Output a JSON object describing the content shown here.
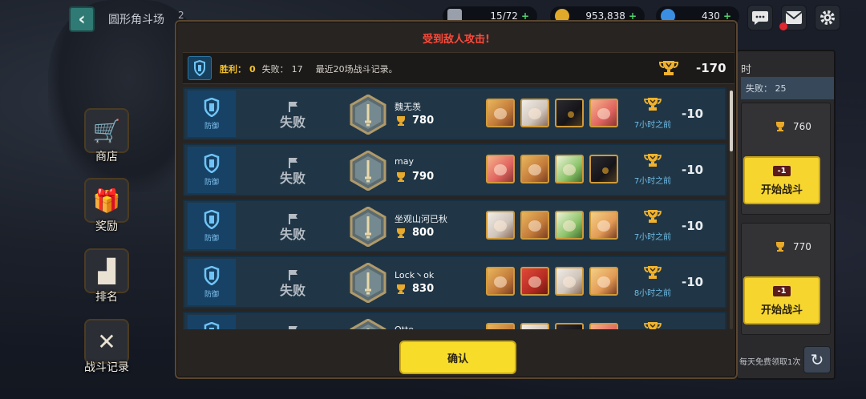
{
  "header": {
    "back_icon": "chevron-left-icon",
    "title": "圆形角斗场",
    "badge": "2",
    "resources": [
      {
        "icon": "stamina-icon",
        "value": "15/72"
      },
      {
        "icon": "gold-coin-icon",
        "value": "953,838"
      },
      {
        "icon": "gem-icon",
        "value": "430"
      }
    ]
  },
  "sidebar": {
    "items": [
      {
        "label": "商店",
        "icon": "cart-icon"
      },
      {
        "label": "奖励",
        "icon": "gift-icon"
      },
      {
        "label": "排名",
        "icon": "podium-icon"
      },
      {
        "label": "战斗记录",
        "icon": "battle-log-icon"
      }
    ]
  },
  "right_panel": {
    "header": "时",
    "loss_label": "失败：",
    "loss_value": "25",
    "cards": [
      {
        "score": "760",
        "cost": "-1",
        "button": "开始战斗"
      },
      {
        "score": "770",
        "cost": "-1",
        "button": "开始战斗"
      }
    ],
    "free_text": "每天免费领取1次"
  },
  "modal": {
    "title": "受到敌人攻击!",
    "summary": {
      "win_label": "胜利：",
      "win_value": "0",
      "loss_label": "失败：",
      "loss_value": "17",
      "note": "最近20场战斗记录。",
      "total": "-170"
    },
    "rows": [
      {
        "role": "防御",
        "result": "失败",
        "name": "魏无羡",
        "score": "780",
        "heroes": [
          "blonde",
          "white",
          "dark",
          "pink"
        ],
        "time": "7小时之前",
        "delta": "-10"
      },
      {
        "role": "防御",
        "result": "失败",
        "name": "may",
        "score": "790",
        "heroes": [
          "pink",
          "blonde",
          "green",
          "dark"
        ],
        "time": "7小时之前",
        "delta": "-10"
      },
      {
        "role": "防御",
        "result": "失败",
        "name": "坐观山河已秋",
        "score": "800",
        "heroes": [
          "white",
          "blonde",
          "green",
          "pirate"
        ],
        "time": "7小时之前",
        "delta": "-10"
      },
      {
        "role": "防御",
        "result": "失败",
        "name": "Lock丶ok",
        "score": "830",
        "heroes": [
          "blonde",
          "red",
          "white",
          "pirate"
        ],
        "time": "8小时之前",
        "delta": "-10"
      },
      {
        "role": "防御",
        "result": "失败",
        "name": "Otto",
        "score": "",
        "heroes": [
          "blonde",
          "white",
          "dark",
          "pink"
        ],
        "time": "",
        "delta": ""
      }
    ],
    "confirm_label": "确认"
  },
  "colors": {
    "accent_yellow": "#f7dc2a",
    "title_red": "#ff4a3a",
    "row_blue": "#203646",
    "time_blue": "#6fbde8"
  }
}
